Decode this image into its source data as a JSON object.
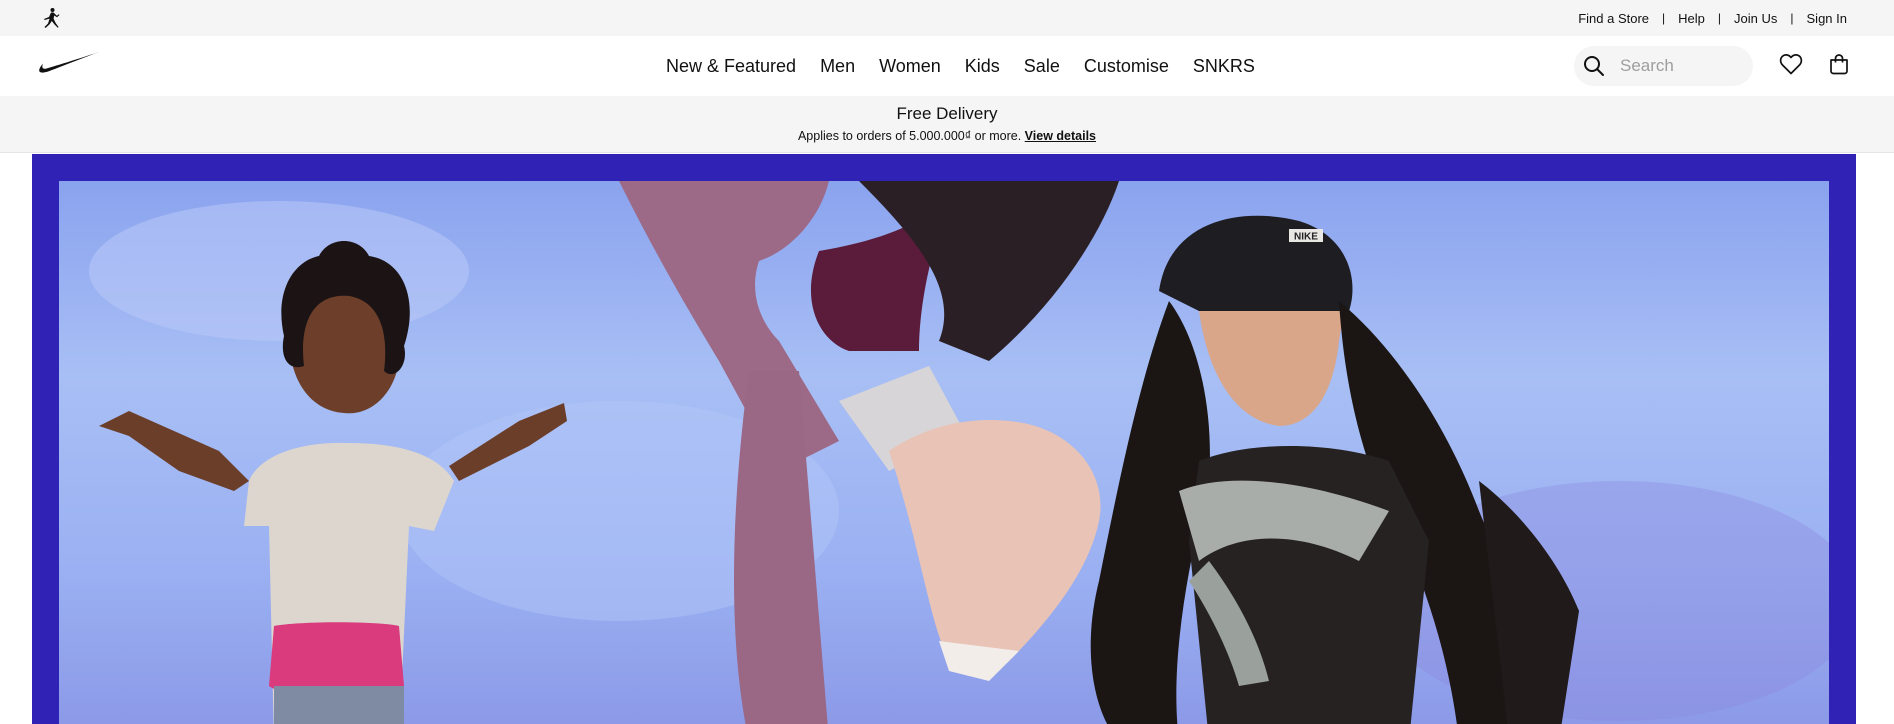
{
  "utility_bar": {
    "links": [
      {
        "label": "Find a Store"
      },
      {
        "label": "Help"
      },
      {
        "label": "Join Us"
      },
      {
        "label": "Sign In"
      }
    ],
    "separator": "|"
  },
  "nav": {
    "items": [
      {
        "label": "New & Featured"
      },
      {
        "label": "Men"
      },
      {
        "label": "Women"
      },
      {
        "label": "Kids"
      },
      {
        "label": "Sale"
      },
      {
        "label": "Customise"
      },
      {
        "label": "SNKRS"
      }
    ],
    "search_placeholder": "Search"
  },
  "promo": {
    "title": "Free Delivery",
    "subtitle": "Applies to orders of 5.000.000₫ or more.",
    "link": "View details"
  },
  "hero": {
    "cap_logo_text": "NIKE",
    "frame_color": "#2f22b5",
    "sky_color": "#a8bff5"
  },
  "icons": {
    "brand_logo": "nike-swoosh-icon",
    "sub_brand_logo": "jordan-jumpman-icon",
    "search": "search-icon",
    "favorites": "heart-icon",
    "bag": "bag-icon"
  }
}
